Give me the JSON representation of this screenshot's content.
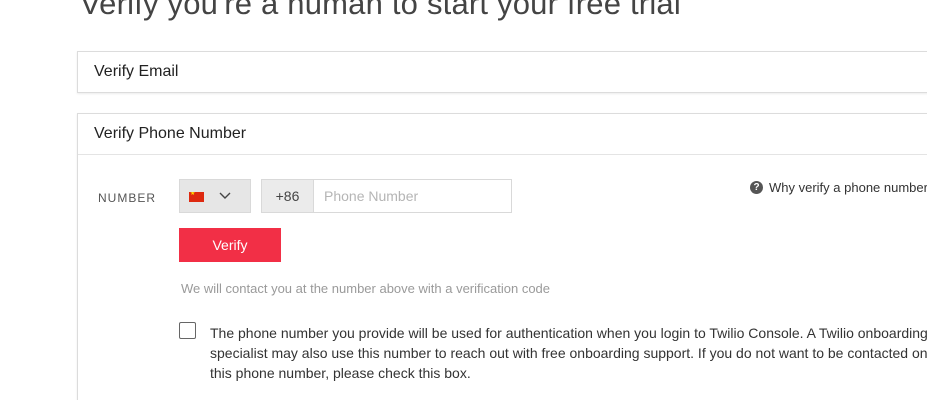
{
  "page": {
    "title": "Verify you're a human to start your free trial"
  },
  "email_section": {
    "title": "Verify Email"
  },
  "phone_section": {
    "title": "Verify Phone Number",
    "number_label": "NUMBER",
    "country": {
      "selected_flag": "china-flag-icon",
      "dial_code": "+86"
    },
    "phone_input": {
      "value": "",
      "placeholder": "Phone Number"
    },
    "verify_button_label": "Verify",
    "help_text": "We will contact you at the number above with a verification code",
    "why_link": {
      "icon": "question-circle-icon",
      "label": "Why verify a phone number?"
    },
    "consent": {
      "checked": false,
      "text": "The phone number you provide will be used for authentication when you login to Twilio Console. A Twilio onboarding specialist may also use this number to reach out with free onboarding support. If you do not want to be contacted on this phone number, please check this box."
    }
  },
  "colors": {
    "accent": "#f22f46",
    "flag_red": "#de2910",
    "flag_yellow": "#ffde00"
  }
}
